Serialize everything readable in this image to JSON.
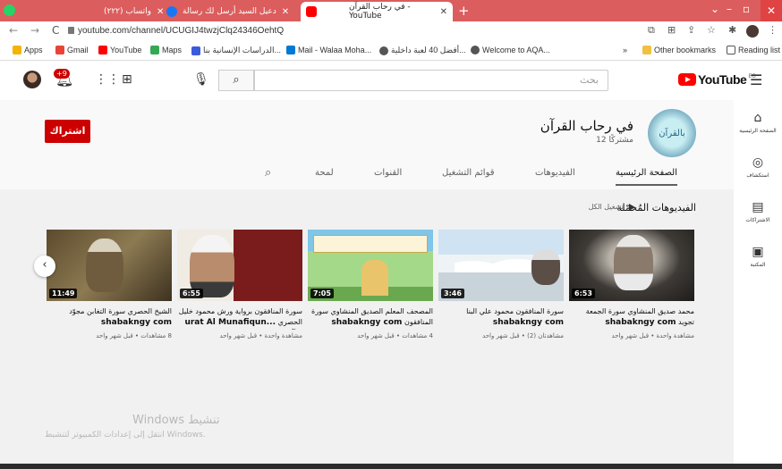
{
  "browser": {
    "tabs": [
      {
        "label": "واتساب (٢٢٢)",
        "active": false,
        "color": "#25d366"
      },
      {
        "label": "دعيل السيد أرسل لك رسالة",
        "active": false,
        "color": "#1877f2"
      },
      {
        "label": "في رحاب القرآن - YouTube",
        "active": true,
        "color": "#ff0000"
      }
    ],
    "url": "youtube.com/channel/UCUGIJ4twzjClq24346OehtQ",
    "bookmarks": [
      {
        "label": "Apps",
        "color": "#f4b400"
      },
      {
        "label": "Gmail",
        "color": "#ea4335"
      },
      {
        "label": "YouTube",
        "color": "#ff0000"
      },
      {
        "label": "Maps",
        "color": "#34a853"
      },
      {
        "label": "الدراسات الإنسانية بنا...",
        "color": "#3b5bdb"
      },
      {
        "label": "Mail - Walaa Moha...",
        "color": "#0078d4"
      },
      {
        "label": "أفضل 40 لعبة داخلية...",
        "color": "#444"
      },
      {
        "label": "Welcome to AQA...",
        "color": "#444"
      }
    ],
    "other_bookmarks": "Other bookmarks",
    "reading_list": "Reading list",
    "bookmarks_more": "»"
  },
  "masthead": {
    "search_placeholder": "بحث",
    "logo_text": "YouTube",
    "logo_region": "EG",
    "notif_count": "+9"
  },
  "channel": {
    "name": "في رحاب القرآن",
    "subscribers": "12 مشتركًا",
    "subscribe_label": "اشتراك",
    "avatar_text": "بالقرآن"
  },
  "tabs": [
    {
      "label": "الصفحة الرئيسية",
      "active": true
    },
    {
      "label": "الفيديوهات",
      "active": false
    },
    {
      "label": "قوائم التشغيل",
      "active": false
    },
    {
      "label": "القنوات",
      "active": false
    },
    {
      "label": "لمحة",
      "active": false
    }
  ],
  "shelf": {
    "title": "الفيديوهات المُحمّلة",
    "play_all": "تشغيل الكل"
  },
  "videos": [
    {
      "title_ar": "محمد صديق المنشاوي سورة الجمعة تجويد",
      "title_latin": "shabakngy com",
      "meta": "مشاهدة واحدة • قبل شهر واحد",
      "duration": "6:53"
    },
    {
      "title_ar": "سورة المنافقون محمود علي البنا",
      "title_latin": "shabakngy com",
      "meta": "مشاهدتان (2) • قبل شهر واحد",
      "duration": "3:46"
    },
    {
      "title_ar": "المصحف المعلم الصديق المنشاوي سورة المنافقون",
      "title_latin": "shabakngy com",
      "meta": "4 مشاهدات • قبل شهر واحد",
      "duration": "7:05"
    },
    {
      "title_ar": "سورة المنافقون برواية ورش محمود خليل الحصري",
      "title_latin": "...urat Al Munafiqun By",
      "meta": "مشاهدة واحدة • قبل شهر واحد",
      "duration": "6:55"
    },
    {
      "title_ar": "الشيخ الحصري سورة التغابن مجوّد",
      "title_latin": "shabakngy com",
      "meta": "8 مشاهدات • قبل شهر واحد",
      "duration": "11:49"
    }
  ],
  "guide": [
    {
      "label": "الصفحة الرئيسية",
      "icon": "⌂"
    },
    {
      "label": "استكشاف",
      "icon": "◎"
    },
    {
      "label": "الاشتراكات",
      "icon": "▤"
    },
    {
      "label": "المكتبة",
      "icon": "▣"
    }
  ],
  "watermark": {
    "line1": "Windows تنشيط",
    "line2": "انتقل إلى إعدادات الكمبيوتر لتنشيط Windows."
  }
}
